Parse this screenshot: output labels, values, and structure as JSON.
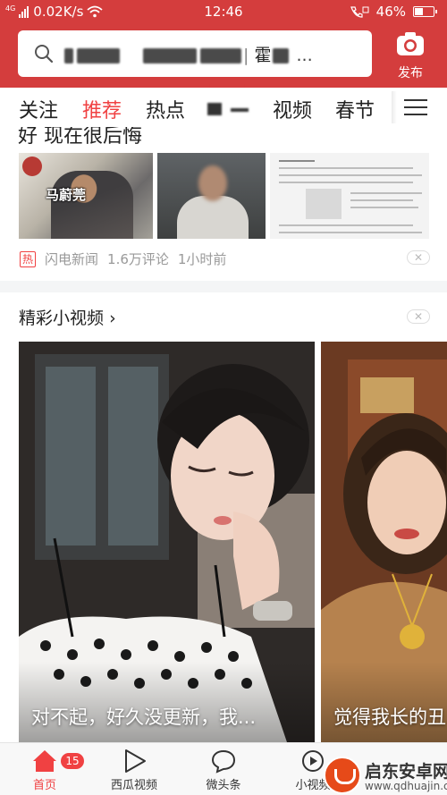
{
  "status_bar": {
    "signal_label": "4G",
    "network_speed": "0.02K/s",
    "time": "12:46",
    "battery_percent": "46%",
    "battery_level": 0.46
  },
  "search": {
    "placeholder_text": "霍"
  },
  "publish": {
    "label": "发布"
  },
  "tabs": [
    {
      "label": "关注",
      "active": false
    },
    {
      "label": "推荐",
      "active": true
    },
    {
      "label": "热点",
      "active": false
    },
    {
      "label": "",
      "active": false
    },
    {
      "label": "视频",
      "active": false
    },
    {
      "label": "春节",
      "active": false
    }
  ],
  "news_card": {
    "title": "好 现在很后悔",
    "thumb1_label": "马蔚莞",
    "tag": "热",
    "source": "闪电新闻",
    "comments": "1.6万评论",
    "time_ago": "1小时前"
  },
  "videos": {
    "section_title": "精彩小视频",
    "items": [
      {
        "caption": "对不起，好久没更新，我..."
      },
      {
        "caption": "觉得我长的丑"
      }
    ]
  },
  "bottom_nav": {
    "items": [
      {
        "label": "首页",
        "active": true,
        "badge": "15"
      },
      {
        "label": "西瓜视频",
        "active": false
      },
      {
        "label": "微头条",
        "active": false
      },
      {
        "label": "小视频",
        "active": false
      }
    ]
  },
  "watermark": {
    "name": "启东安卓网",
    "url": "www.qdhuajin.com"
  },
  "colors": {
    "brand_red": "#d43d3d",
    "accent_red": "#f04142"
  }
}
